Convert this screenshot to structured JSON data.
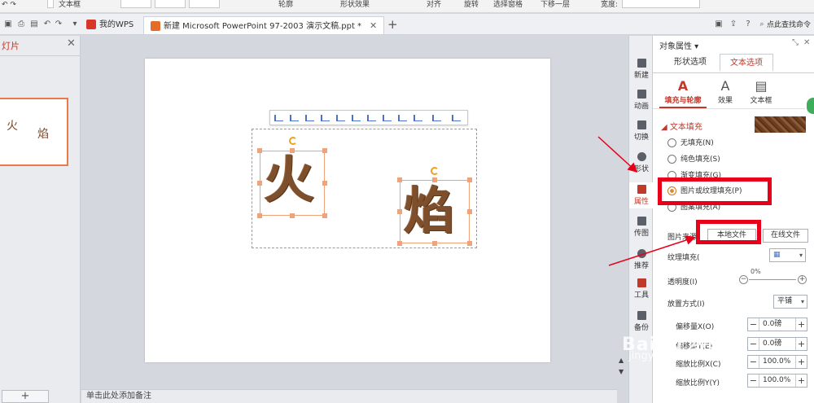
{
  "ribbon": {
    "textbox_label": "文本框",
    "outline_label": "轮廓",
    "shape_effect_label": "形状效果",
    "align_label": "对齐",
    "rotate_label": "旋转",
    "selection_pane_label": "选择窗格",
    "move_down_label": "下移一层",
    "width_label": "宽度:"
  },
  "tabbar": {
    "tabs": [
      {
        "label": "我的WPS"
      },
      {
        "label": "新建 Microsoft PowerPoint 97-2003 演示文稿.ppt *"
      }
    ],
    "search_label": "点此查找命令"
  },
  "left_pane": {
    "title": "灯片",
    "thumb_chars": [
      "火",
      "焰"
    ]
  },
  "slide": {
    "chars": [
      "火",
      "焰"
    ]
  },
  "notes": {
    "placeholder": "单击此处添加备注"
  },
  "iconbar": {
    "items": [
      {
        "label": "新建",
        "icon": "new-icon"
      },
      {
        "label": "动画",
        "icon": "animation-icon"
      },
      {
        "label": "切换",
        "icon": "transition-icon"
      },
      {
        "label": "形状",
        "icon": "shape-icon"
      },
      {
        "label": "属性",
        "icon": "properties-icon"
      },
      {
        "label": "传图",
        "icon": "upload-image-icon"
      },
      {
        "label": "推荐",
        "icon": "recommend-icon"
      },
      {
        "label": "工具",
        "icon": "tools-icon"
      },
      {
        "label": "备份",
        "icon": "backup-icon"
      }
    ]
  },
  "panel": {
    "title": "对象属性",
    "tabs": [
      "形状选项",
      "文本选项"
    ],
    "subtabs": [
      {
        "label": "填充与轮廓",
        "glyph": "A"
      },
      {
        "label": "效果",
        "glyph": "A"
      },
      {
        "label": "文本框",
        "glyph": "▤"
      }
    ],
    "section_title": "文本填充",
    "fill_options": [
      "无填充(N)",
      "纯色填充(S)",
      "渐变填充(G)",
      "图片或纹理填充(P)",
      "图案填充(A)"
    ],
    "picture_source_label": "图片来源",
    "local_file_button": "本地文件",
    "online_file_button": "在线文件",
    "texture_fill_label": "纹理填充(",
    "transparency_label": "透明度(I)",
    "transparency_value": "0%",
    "placement_label": "放置方式(I)",
    "placement_value": "平铺",
    "offset_x_label": "偏移量X(O)",
    "offset_x_value": "0.0磅",
    "offset_y_label": "偏移量Y(E)",
    "offset_y_value": "0.0磅",
    "scale_x_label": "缩放比例X(C)",
    "scale_x_value": "100.0%",
    "scale_y_label": "缩放比例Y(Y)",
    "scale_y_value": "100.0%"
  },
  "watermark": {
    "text": "Baidu 经验",
    "url": "jingyan.baidu.com"
  },
  "colors": {
    "accent": "#c0392b",
    "highlight": "#e8001a",
    "selection": "#f0a27a",
    "texture": "#7d4f2d"
  }
}
